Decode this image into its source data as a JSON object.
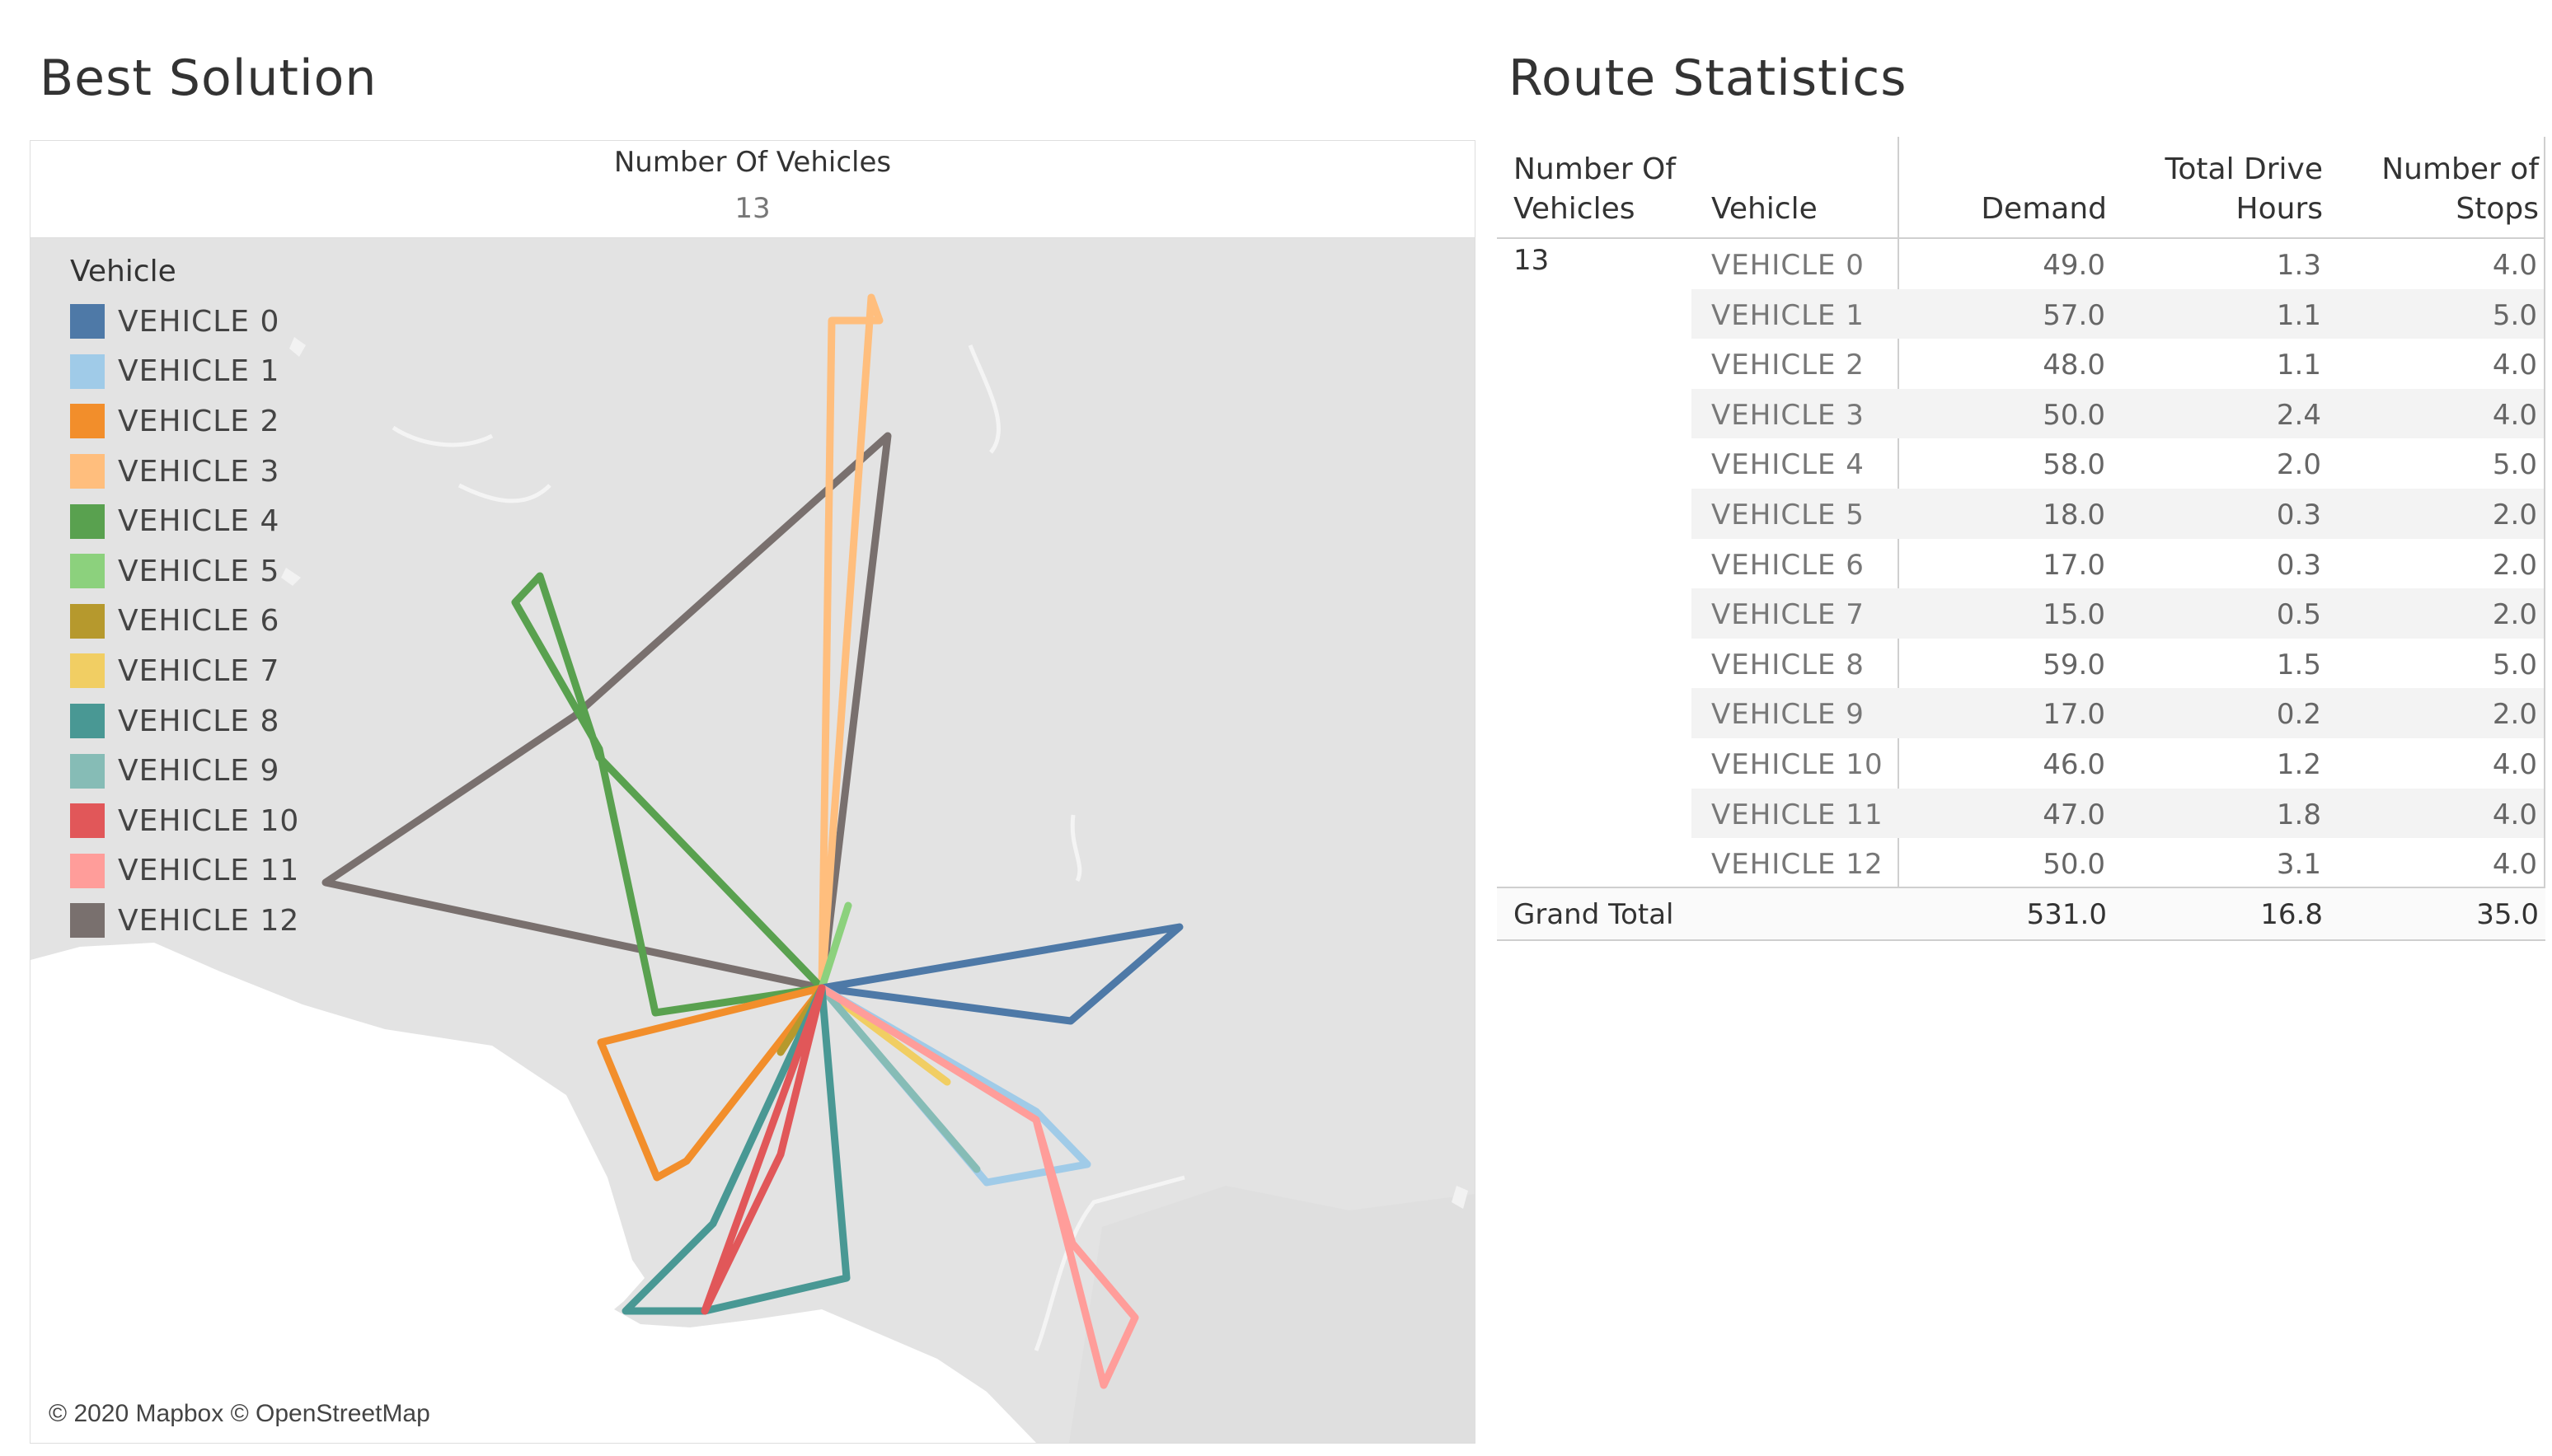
{
  "left_panel": {
    "title": "Best Solution",
    "kpi_label": "Number Of Vehicles",
    "kpi_value": "13",
    "legend_title": "Vehicle",
    "map_credit": "© 2020 Mapbox © OpenStreetMap"
  },
  "right_panel": {
    "title": "Route Statistics",
    "headers": {
      "number_of_vehicles": "Number Of\nVehicles",
      "vehicle": "Vehicle",
      "demand": "Demand",
      "total_drive_hours": "Total Drive\nHours",
      "number_of_stops": "Number of\nStops"
    },
    "number_of_vehicles_value": "13",
    "rows": [
      {
        "vehicle": "VEHICLE 0",
        "demand": "49.0",
        "hours": "1.3",
        "stops": "4.0"
      },
      {
        "vehicle": "VEHICLE 1",
        "demand": "57.0",
        "hours": "1.1",
        "stops": "5.0"
      },
      {
        "vehicle": "VEHICLE 2",
        "demand": "48.0",
        "hours": "1.1",
        "stops": "4.0"
      },
      {
        "vehicle": "VEHICLE 3",
        "demand": "50.0",
        "hours": "2.4",
        "stops": "4.0"
      },
      {
        "vehicle": "VEHICLE 4",
        "demand": "58.0",
        "hours": "2.0",
        "stops": "5.0"
      },
      {
        "vehicle": "VEHICLE 5",
        "demand": "18.0",
        "hours": "0.3",
        "stops": "2.0"
      },
      {
        "vehicle": "VEHICLE 6",
        "demand": "17.0",
        "hours": "0.3",
        "stops": "2.0"
      },
      {
        "vehicle": "VEHICLE 7",
        "demand": "15.0",
        "hours": "0.5",
        "stops": "2.0"
      },
      {
        "vehicle": "VEHICLE 8",
        "demand": "59.0",
        "hours": "1.5",
        "stops": "5.0"
      },
      {
        "vehicle": "VEHICLE 9",
        "demand": "17.0",
        "hours": "0.2",
        "stops": "2.0"
      },
      {
        "vehicle": "VEHICLE 10",
        "demand": "46.0",
        "hours": "1.2",
        "stops": "4.0"
      },
      {
        "vehicle": "VEHICLE 11",
        "demand": "47.0",
        "hours": "1.8",
        "stops": "4.0"
      },
      {
        "vehicle": "VEHICLE 12",
        "demand": "50.0",
        "hours": "3.1",
        "stops": "4.0"
      }
    ],
    "grand_total": {
      "label": "Grand Total",
      "demand": "531.0",
      "hours": "16.8",
      "stops": "35.0"
    }
  },
  "vehicles": [
    {
      "name": "VEHICLE 0",
      "color": "#4e79a7"
    },
    {
      "name": "VEHICLE 1",
      "color": "#a0cbe8"
    },
    {
      "name": "VEHICLE 2",
      "color": "#f28e2b"
    },
    {
      "name": "VEHICLE 3",
      "color": "#ffbe7d"
    },
    {
      "name": "VEHICLE 4",
      "color": "#59a14f"
    },
    {
      "name": "VEHICLE 5",
      "color": "#8cd17d"
    },
    {
      "name": "VEHICLE 6",
      "color": "#b6992d"
    },
    {
      "name": "VEHICLE 7",
      "color": "#f1ce63"
    },
    {
      "name": "VEHICLE 8",
      "color": "#499894"
    },
    {
      "name": "VEHICLE 9",
      "color": "#86bcb6"
    },
    {
      "name": "VEHICLE 10",
      "color": "#e15759"
    },
    {
      "name": "VEHICLE 11",
      "color": "#ff9d9a"
    },
    {
      "name": "VEHICLE 12",
      "color": "#79706e"
    }
  ]
}
